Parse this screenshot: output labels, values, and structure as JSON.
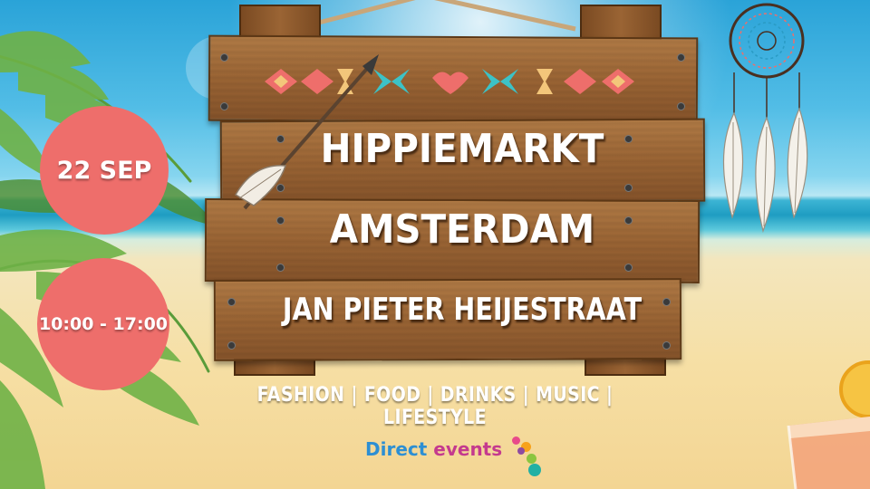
{
  "event": {
    "date": "22 SEP",
    "time": "10:00 - 17:00",
    "title_line1": "HIPPIEMARKT",
    "title_line2": "AMSTERDAM",
    "title_line3": "JAN PIETER HEIJESTRAAT",
    "tagline": "FASHION | FOOD | DRINKS | MUSIC | LIFESTYLE"
  },
  "logo": {
    "word1": "Direct",
    "word2": "events"
  },
  "colors": {
    "badge": "#ee6e6b",
    "wood": "#9a6434",
    "sky": "#2aa3d8",
    "sand": "#f3d593"
  },
  "icons": {
    "arrow": "arrow-icon",
    "dreamcatcher": "dreamcatcher-icon",
    "palm": "palm-leaf-icon",
    "drink": "drink-glass-icon"
  }
}
